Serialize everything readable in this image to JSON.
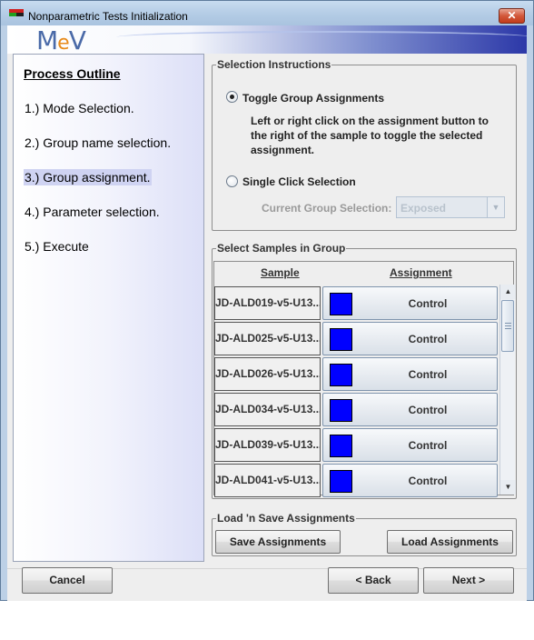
{
  "window": {
    "title": "Nonparametric Tests Initialization",
    "close_glyph": "✕"
  },
  "banner": {
    "logo_prefix": "M",
    "logo_e": "e",
    "logo_suffix": "V"
  },
  "outline": {
    "title": "Process Outline",
    "steps": [
      "1.) Mode Selection.",
      "2.) Group name selection.",
      "3.) Group assignment.",
      "4.) Parameter selection.",
      "5.) Execute"
    ],
    "active_step_index": 2
  },
  "selection_instructions": {
    "legend": "Selection Instructions",
    "toggle_label": "Toggle Group Assignments",
    "toggle_selected": true,
    "instructions": "Left or right click on the assignment button to the right of the sample to toggle the selected assignment.",
    "single_click_label": "Single Click Selection",
    "single_click_selected": false,
    "current_group_label": "Current Group Selection:",
    "current_group_value": "Exposed"
  },
  "samples_group": {
    "legend": "Select Samples in Group",
    "column_sample": "Sample",
    "column_assignment": "Assignment",
    "rows": [
      {
        "sample": "JD-ALD019-v5-U13...",
        "assignment": "Control",
        "color": "#0000ff"
      },
      {
        "sample": "JD-ALD025-v5-U13...",
        "assignment": "Control",
        "color": "#0000ff"
      },
      {
        "sample": "JD-ALD026-v5-U13...",
        "assignment": "Control",
        "color": "#0000ff"
      },
      {
        "sample": "JD-ALD034-v5-U13...",
        "assignment": "Control",
        "color": "#0000ff"
      },
      {
        "sample": "JD-ALD039-v5-U13...",
        "assignment": "Control",
        "color": "#0000ff"
      },
      {
        "sample": "JD-ALD041-v5-U13...",
        "assignment": "Control",
        "color": "#0000ff"
      }
    ]
  },
  "load_save": {
    "legend": "Load 'n Save Assignments",
    "save_label": "Save Assignments",
    "load_label": "Load Assignments"
  },
  "footer": {
    "cancel_label": "Cancel",
    "back_label": "< Back",
    "next_label": "Next >"
  },
  "icons": {
    "scroll_up": "▲",
    "scroll_down": "▼",
    "combo_arrow": "▼"
  }
}
